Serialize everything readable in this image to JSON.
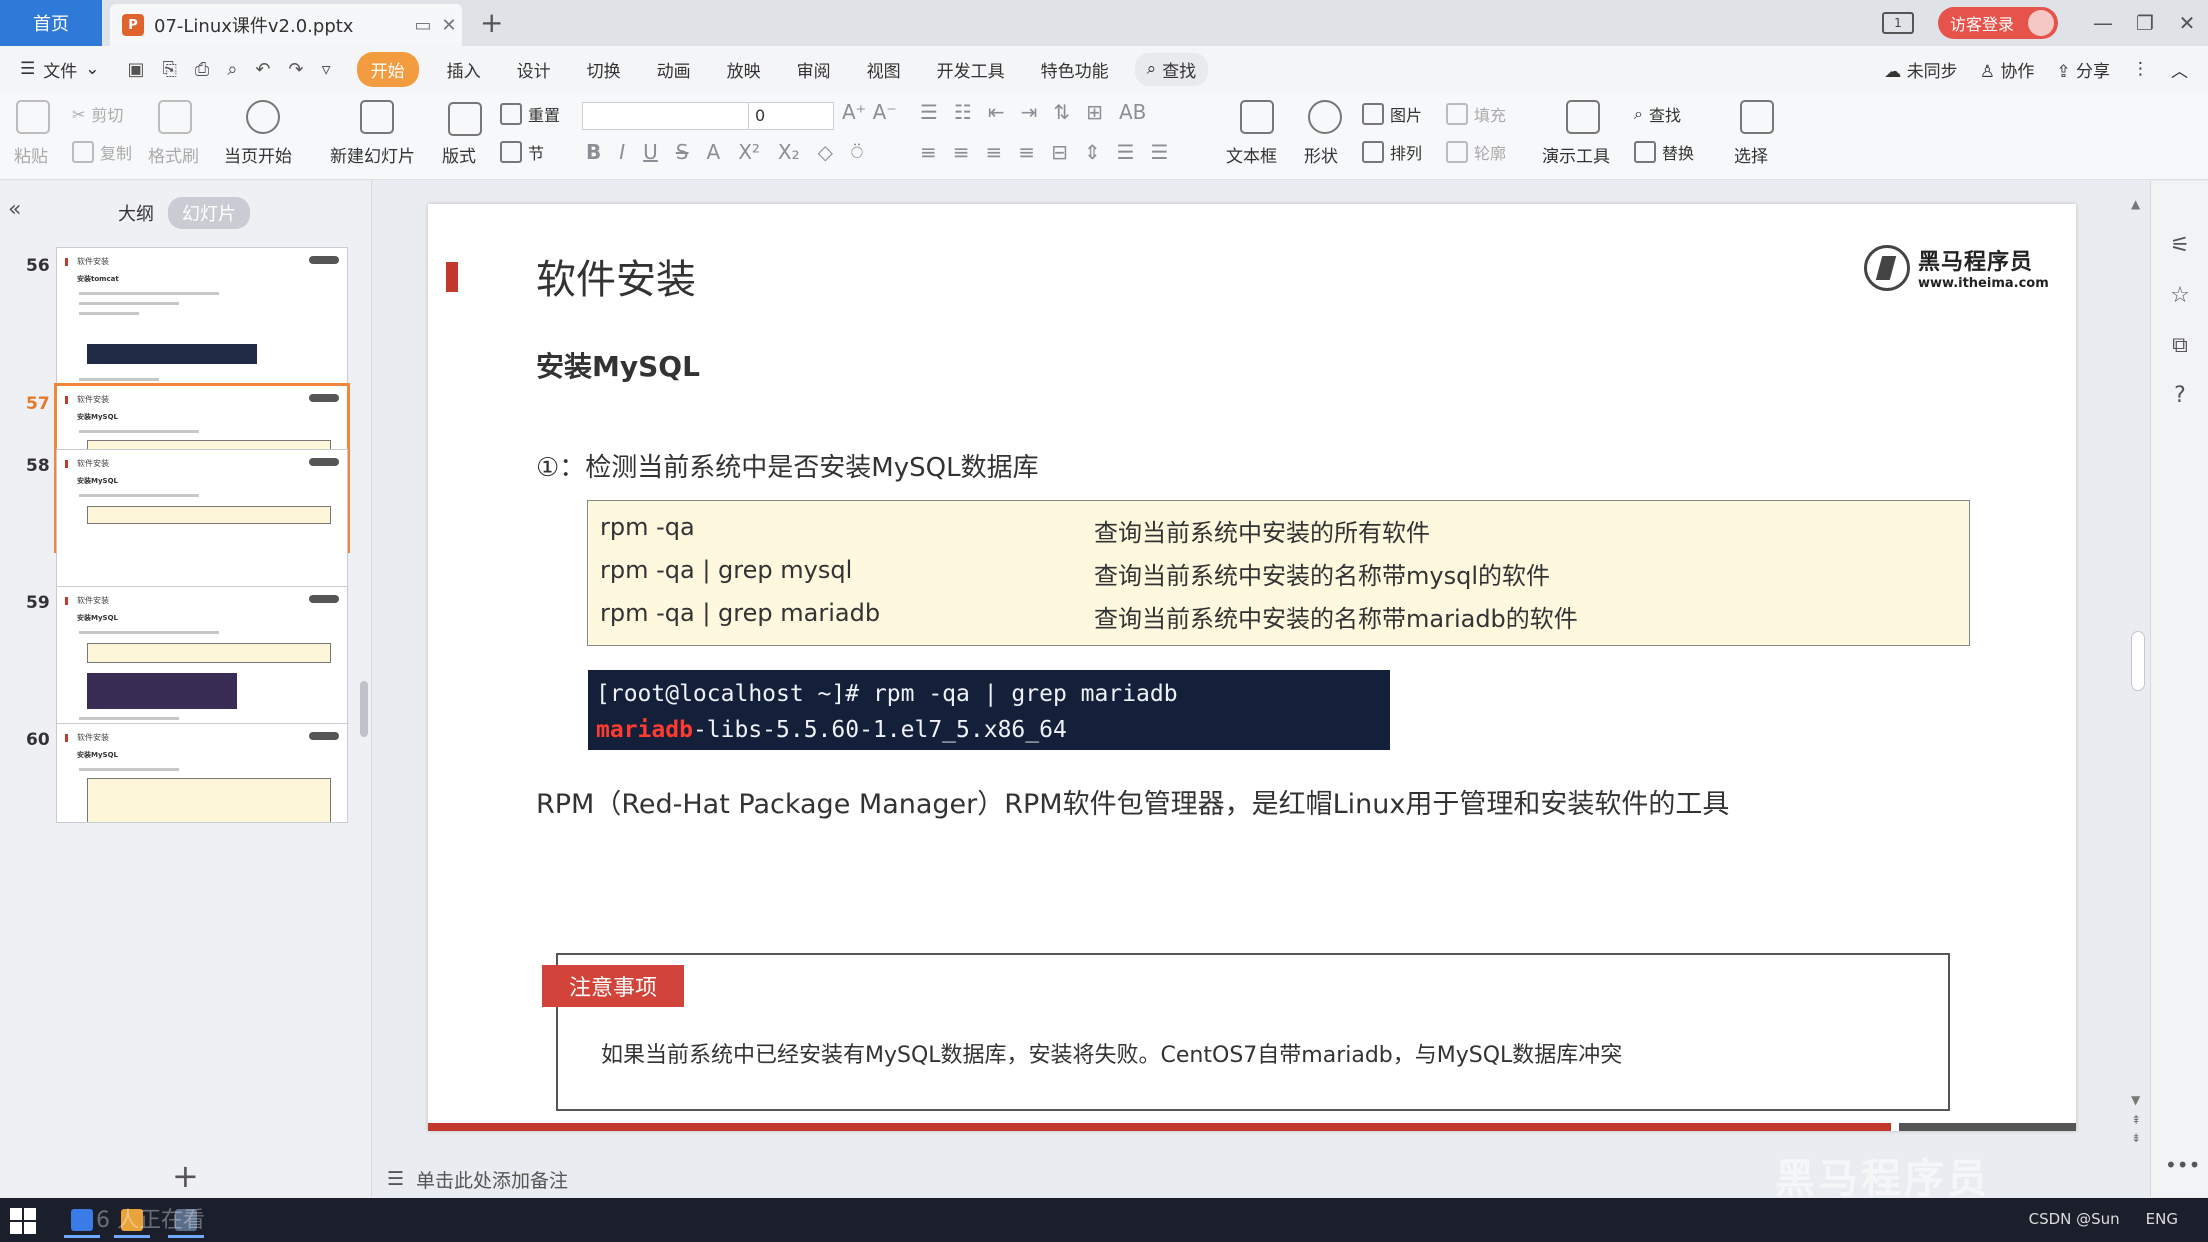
{
  "titlebar": {
    "home_tab": "首页",
    "doc_tab": "07-Linux课件v2.0.pptx",
    "ppt_badge": "P",
    "layout_badge": "1",
    "visitor_login": "访客登录"
  },
  "menu": {
    "file": "文件",
    "items": [
      "开始",
      "插入",
      "设计",
      "切换",
      "动画",
      "放映",
      "审阅",
      "视图",
      "开发工具",
      "特色功能"
    ],
    "search": "查找",
    "sync": "未同步",
    "collab": "协作",
    "share": "分享"
  },
  "ribbon": {
    "paste": "粘贴",
    "cut": "剪切",
    "copy": "复制",
    "format_painter": "格式刷",
    "start_from_current": "当页开始",
    "new_slide": "新建幻灯片",
    "layout": "版式",
    "reset": "重置",
    "section": "节",
    "font_size_value": "0",
    "textbox": "文本框",
    "shape": "形状",
    "picture": "图片",
    "fill": "填充",
    "arrange": "排列",
    "outline": "轮廓",
    "present_tools": "演示工具",
    "find": "查找",
    "replace": "替换",
    "select": "选择"
  },
  "leftpanel": {
    "tab_outline": "大纲",
    "tab_slides": "幻灯片",
    "slide_numbers": [
      "56",
      "57",
      "58",
      "59",
      "60"
    ],
    "thumb_titles": [
      "软件安装",
      "软件安装",
      "软件安装",
      "软件安装",
      "软件安装"
    ],
    "thumb_subtitles": [
      "安装tomcat",
      "安装MySQL",
      "安装MySQL",
      "安装MySQL",
      "安装MySQL"
    ]
  },
  "slide": {
    "title": "软件安装",
    "logo_name": "黑马程序员",
    "logo_url": "www.itheima.com",
    "subtitle": "安装MySQL",
    "step": "①：检测当前系统中是否安装MySQL数据库",
    "commands": [
      {
        "cmd": "rpm -qa",
        "desc": "查询当前系统中安装的所有软件"
      },
      {
        "cmd": "rpm -qa | grep mysql",
        "desc": "查询当前系统中安装的名称带mysql的软件"
      },
      {
        "cmd": "rpm -qa | grep mariadb",
        "desc": "查询当前系统中安装的名称带mariadb的软件"
      }
    ],
    "terminal_line1": "[root@localhost ~]# rpm -qa | grep mariadb",
    "terminal_line2_hl": "mariadb",
    "terminal_line2_rest": "-libs-5.5.60-1.el7_5.x86_64",
    "rpm_desc": "RPM（Red-Hat Package Manager）RPM软件包管理器，是红帽Linux用于管理和安装软件的工具",
    "note_tag": "注意事项",
    "note_text": "如果当前系统中已经安装有MySQL数据库，安装将失败。CentOS7自带mariadb，与MySQL数据库冲突"
  },
  "notes": {
    "placeholder": "单击此处添加备注"
  },
  "watermark": "黑马程序员",
  "taskbar": {
    "viewers": "6 人正在看",
    "lang": "ENG",
    "csdn": "CSDN @Sun"
  },
  "colors": {
    "accent_orange": "#f39c3f",
    "home_tab_blue": "#2f7ad9",
    "slide_red": "#c0392b",
    "note_yellow": "#fdf8de",
    "terminal_bg": "#14203a"
  }
}
